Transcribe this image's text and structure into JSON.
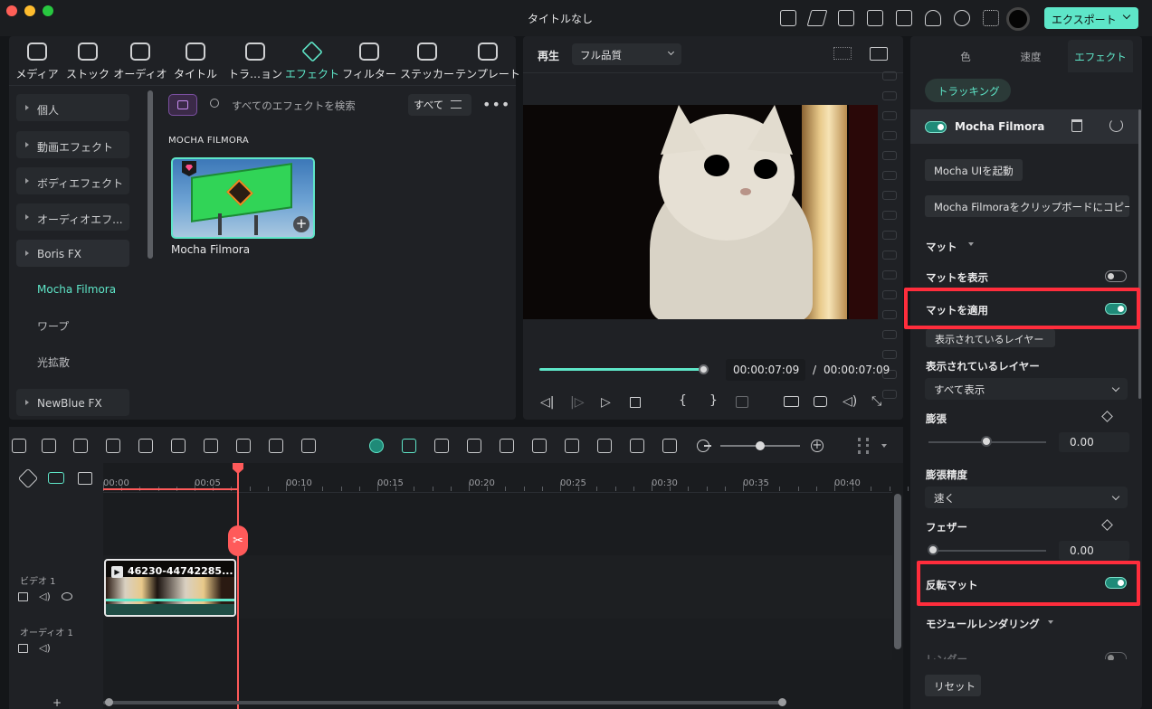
{
  "window": {
    "title": "タイトルなし",
    "export_label": "エクスポート"
  },
  "media_tabs": [
    {
      "label": "メディア",
      "icon": "media-icon"
    },
    {
      "label": "ストック",
      "icon": "stock-icon"
    },
    {
      "label": "オーディオ",
      "icon": "audio-icon"
    },
    {
      "label": "タイトル",
      "icon": "title-icon"
    },
    {
      "label": "トラ…ョン",
      "icon": "transition-icon"
    },
    {
      "label": "エフェクト",
      "icon": "effect-icon",
      "active": true
    },
    {
      "label": "フィルター",
      "icon": "filter-icon"
    },
    {
      "label": "ステッカー",
      "icon": "sticker-icon"
    },
    {
      "label": "テンプレート",
      "icon": "template-icon"
    }
  ],
  "sidebar": {
    "items": [
      {
        "label": "個人"
      },
      {
        "label": "動画エフェクト"
      },
      {
        "label": "ボディエフェクト"
      },
      {
        "label": "オーディオエフ..."
      },
      {
        "label": "Boris FX"
      }
    ],
    "sub_items": [
      {
        "label": "Mocha Filmora",
        "active": true
      },
      {
        "label": "ワープ"
      },
      {
        "label": "光拡散"
      }
    ],
    "last_item": "NewBlue FX"
  },
  "effects": {
    "search_placeholder": "すべてのエフェクトを検索",
    "filter_label": "すべて",
    "section_title": "MOCHA FILMORA",
    "card_label": "Mocha Filmora"
  },
  "player": {
    "play_label": "再生",
    "quality": "フル品質",
    "current_time": "00:00:07:09",
    "separator": "/",
    "total_time": "00:00:07:09",
    "progress": 0.99
  },
  "right_panel": {
    "tabs": [
      {
        "label": "色"
      },
      {
        "label": "速度"
      },
      {
        "label": "エフェクト",
        "active": true
      }
    ],
    "tracking_label": "トラッキング",
    "effect_name": "Mocha Filmora",
    "launch_ui": "Mocha UIを起動",
    "copy_clipboard": "Mocha Filmoraをクリップボードにコピー",
    "matte_section": "マット",
    "show_matte": "マットを表示",
    "apply_matte": "マットを適用",
    "visible_layers_button": "表示されているレイヤー",
    "visible_layers_label": "表示されているレイヤー",
    "visible_layers_value": "すべて表示",
    "dilate_label": "膨張",
    "dilate_value": "0.00",
    "dilate_precision_label": "膨張精度",
    "dilate_precision_value": "速く",
    "feather_label": "フェザー",
    "feather_value": "0.00",
    "invert_matte": "反転マット",
    "module_render": "モジュールレンダリング",
    "render_label": "レンダー",
    "reset_label": "リセット",
    "highlight_color": "#ff2d3c",
    "accent_color": "#5ee6c8"
  },
  "timeline": {
    "ticks": [
      "00:00",
      "00:05",
      "00:10",
      "00:15",
      "00:20",
      "00:25",
      "00:30",
      "00:35",
      "00:40"
    ],
    "video_track": "ビデオ 1",
    "audio_track": "オーディオ 1",
    "clip_name": "46230-44742285..."
  }
}
